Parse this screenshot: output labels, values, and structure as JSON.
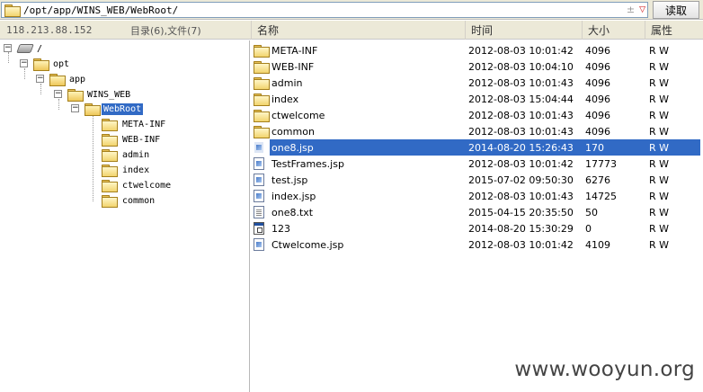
{
  "path_bar": {
    "path": "/opt/app/WINS_WEB/WebRoot/",
    "read_button": "读取",
    "control_glyph": "±",
    "dropdown_glyph": "▽"
  },
  "host": {
    "ip": "118.213.88.152",
    "summary": "目录(6),文件(7)"
  },
  "columns": {
    "name": "名称",
    "time": "时间",
    "size": "大小",
    "attr": "属性"
  },
  "tree": {
    "root": "/",
    "nodes": [
      {
        "label": "opt",
        "expanded": true
      },
      {
        "label": "app",
        "expanded": true
      },
      {
        "label": "WINS_WEB",
        "expanded": true
      },
      {
        "label": "WebRoot",
        "expanded": true,
        "selected": true
      }
    ],
    "children": [
      "META-INF",
      "WEB-INF",
      "admin",
      "index",
      "ctwelcome",
      "common"
    ]
  },
  "files": [
    {
      "name": "META-INF",
      "time": "2012-08-03 10:01:42",
      "size": "4096",
      "attr": "R W",
      "icon": "folder-icon"
    },
    {
      "name": "WEB-INF",
      "time": "2012-08-03 10:04:10",
      "size": "4096",
      "attr": "R W",
      "icon": "folder-icon"
    },
    {
      "name": "admin",
      "time": "2012-08-03 10:01:43",
      "size": "4096",
      "attr": "R W",
      "icon": "folder-icon"
    },
    {
      "name": "index",
      "time": "2012-08-03 15:04:44",
      "size": "4096",
      "attr": "R W",
      "icon": "folder-icon"
    },
    {
      "name": "ctwelcome",
      "time": "2012-08-03 10:01:43",
      "size": "4096",
      "attr": "R W",
      "icon": "folder-icon"
    },
    {
      "name": "common",
      "time": "2012-08-03 10:01:43",
      "size": "4096",
      "attr": "R W",
      "icon": "folder-icon"
    },
    {
      "name": "one8.jsp",
      "time": "2014-08-20 15:26:43",
      "size": "170",
      "attr": "R W",
      "icon": "jsp-file-icon",
      "selected": true
    },
    {
      "name": "TestFrames.jsp",
      "time": "2012-08-03 10:01:42",
      "size": "17773",
      "attr": "R W",
      "icon": "jsp-file-icon"
    },
    {
      "name": "test.jsp",
      "time": "2015-07-02 09:50:30",
      "size": "6276",
      "attr": "R W",
      "icon": "jsp-file-icon"
    },
    {
      "name": "index.jsp",
      "time": "2012-08-03 10:01:43",
      "size": "14725",
      "attr": "R W",
      "icon": "jsp-file-icon"
    },
    {
      "name": "one8.txt",
      "time": "2015-04-15 20:35:50",
      "size": "50",
      "attr": "R W",
      "icon": "txt-file-icon"
    },
    {
      "name": "123",
      "time": "2014-08-20 15:30:29",
      "size": "0",
      "attr": "R W",
      "icon": "exe-file-icon"
    },
    {
      "name": "Ctwelcome.jsp",
      "time": "2012-08-03 10:01:42",
      "size": "4109",
      "attr": "R W",
      "icon": "jsp-file-icon"
    }
  ],
  "watermark": "www.wooyun.org",
  "colors": {
    "selection": "#316ac5",
    "folder": "#f2d46e",
    "toolbar": "#ece9d8"
  }
}
